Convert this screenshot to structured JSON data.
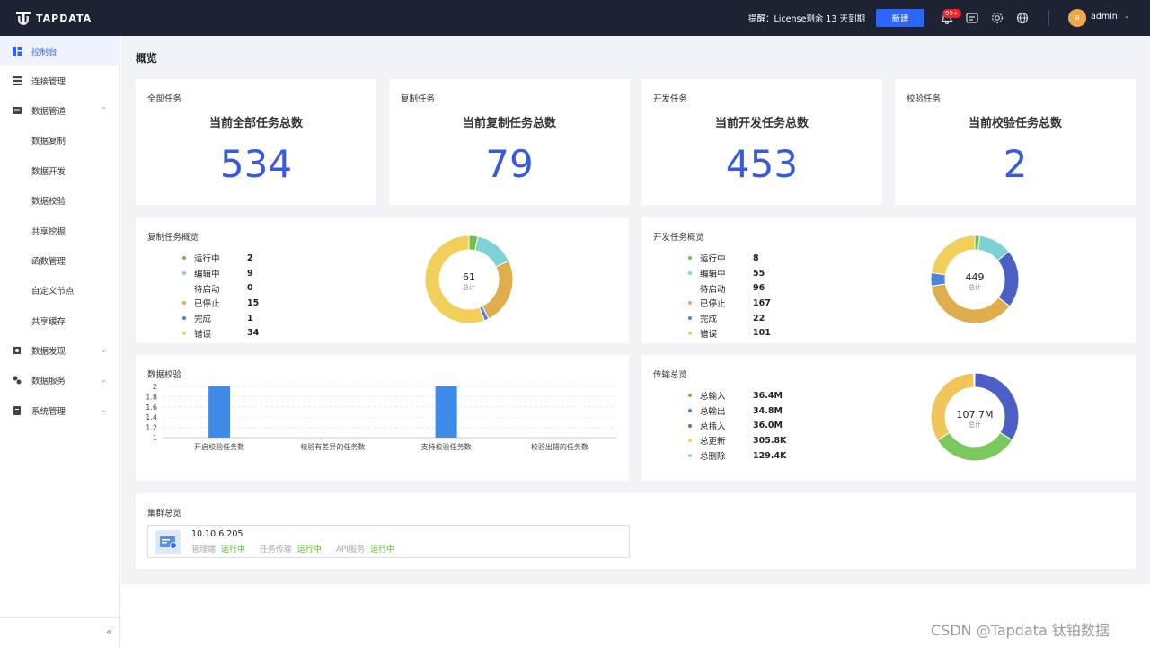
{
  "app": {
    "logo_text": "TAPDATA"
  },
  "topbar": {
    "notice": "提醒：License剩余 13 天到期",
    "new_button": "新建",
    "notify_badge": "99+",
    "avatar_letter": "a",
    "username": "admin",
    "icons": [
      "bell-icon",
      "message-icon",
      "settings-icon",
      "globe-icon"
    ]
  },
  "sidebar": {
    "items": [
      {
        "label": "控制台",
        "icon": "dashboard-icon",
        "active": true
      },
      {
        "label": "连接管理",
        "icon": "connections-icon"
      },
      {
        "label": "数据管道",
        "icon": "pipeline-icon",
        "expanded": true
      },
      {
        "label": "数据复制"
      },
      {
        "label": "数据开发"
      },
      {
        "label": "数据校验"
      },
      {
        "label": "共享挖掘"
      },
      {
        "label": "函数管理"
      },
      {
        "label": "自定义节点"
      },
      {
        "label": "共享缓存"
      },
      {
        "label": "数据发现",
        "icon": "discovery-icon"
      },
      {
        "label": "数据服务",
        "icon": "service-icon"
      },
      {
        "label": "系统管理",
        "icon": "system-icon"
      }
    ]
  },
  "page": {
    "title": "概览"
  },
  "stats": [
    {
      "label": "全部任务",
      "title": "当前全部任务总数",
      "value": "534"
    },
    {
      "label": "复制任务",
      "title": "当前复制任务总数",
      "value": "79"
    },
    {
      "label": "开发任务",
      "title": "当前开发任务总数",
      "value": "453"
    },
    {
      "label": "校验任务",
      "title": "当前校验任务总数",
      "value": "2"
    }
  ],
  "colors": {
    "running": "#6fbf4a",
    "editing": "#7dd3d4",
    "waiting": "#ffffff",
    "stopped": "#e0ad4c",
    "done": "#4b84dc",
    "error": "#f2cf5b",
    "accent": "#2c65ff",
    "number": "#3a5bd9"
  },
  "copy_overview": {
    "label": "复制任务概览",
    "total": "61",
    "total_label": "总计",
    "rows": [
      {
        "name": "运行中",
        "value": "2"
      },
      {
        "name": "编辑中",
        "value": "9"
      },
      {
        "name": "待启动",
        "value": "0"
      },
      {
        "name": "已停止",
        "value": "15"
      },
      {
        "name": "完成",
        "value": "1"
      },
      {
        "name": "错误",
        "value": "34"
      }
    ]
  },
  "dev_overview": {
    "label": "开发任务概览",
    "total": "449",
    "total_label": "总计",
    "rows": [
      {
        "name": "运行中",
        "value": "8"
      },
      {
        "name": "编辑中",
        "value": "55"
      },
      {
        "name": "待启动",
        "value": "96"
      },
      {
        "name": "已停止",
        "value": "167"
      },
      {
        "name": "完成",
        "value": "22"
      },
      {
        "name": "错误",
        "value": "101"
      }
    ]
  },
  "verify": {
    "label": "数据校验"
  },
  "transfer": {
    "label": "传输总览",
    "total": "107.7M",
    "total_label": "总计",
    "rows": [
      {
        "name": "总输入",
        "value": "36.4M",
        "color": "#6fbf4a"
      },
      {
        "name": "总输出",
        "value": "34.8M",
        "color": "#4b84dc"
      },
      {
        "name": "总插入",
        "value": "36.0M",
        "color": "#7a5bd0"
      },
      {
        "name": "总更新",
        "value": "305.8K",
        "color": "#f2cf5b"
      },
      {
        "name": "总删除",
        "value": "129.4K",
        "color": "#7dd3d4"
      }
    ]
  },
  "chart_data": {
    "type": "bar",
    "categories": [
      "开启校验任务数",
      "校验有差异的任务数",
      "支持校验任务数",
      "校验出错的任务数"
    ],
    "values": [
      2,
      0,
      2,
      0
    ],
    "ylim": [
      1,
      2
    ],
    "yticks": [
      "2",
      "1.8",
      "1.6",
      "1.4",
      "1.2",
      "1"
    ],
    "grid": true
  },
  "cluster": {
    "label": "集群总览",
    "ip": "10.10.6.205",
    "services": [
      {
        "name": "管理端",
        "status": "运行中"
      },
      {
        "name": "任务传输",
        "status": "运行中"
      },
      {
        "name": "API服务",
        "status": "运行中"
      }
    ]
  },
  "watermark": "CSDN @Tapdata 钛铂数据"
}
